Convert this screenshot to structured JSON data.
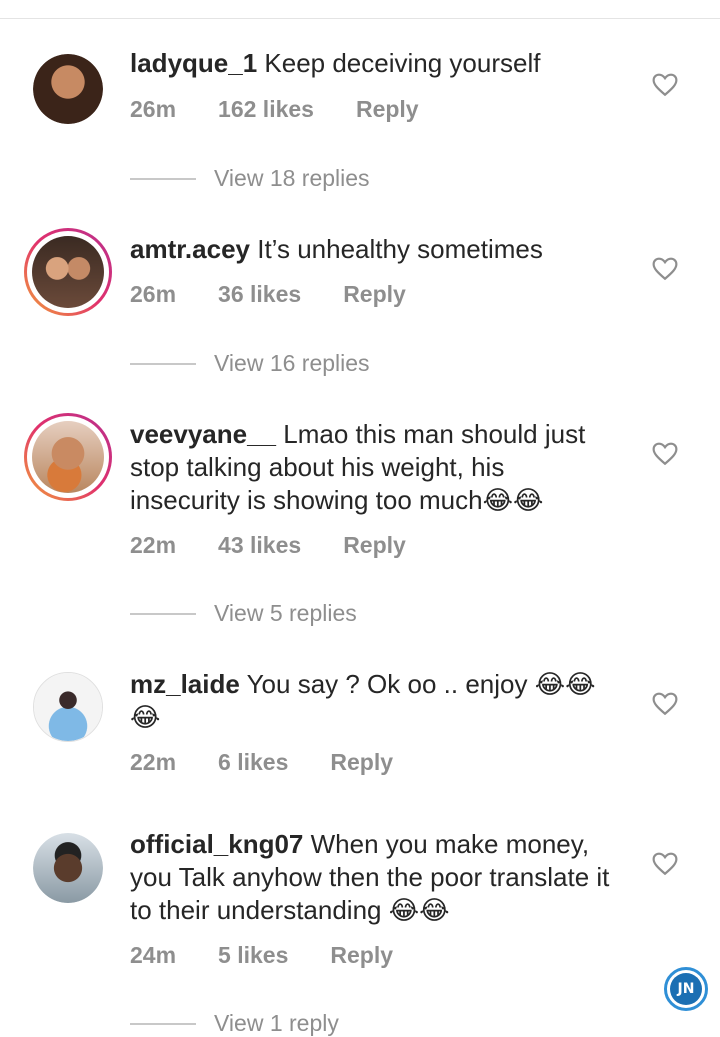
{
  "comments": [
    {
      "username": "ladyque_1",
      "text": "Keep deceiving yourself",
      "time": "26m",
      "likes": "162 likes",
      "reply": "Reply",
      "view_replies": "View 18 replies",
      "avatar_story_ring": false
    },
    {
      "username": "amtr.acey",
      "text": "It’s unhealthy sometimes",
      "time": "26m",
      "likes": "36 likes",
      "reply": "Reply",
      "view_replies": "View 16 replies",
      "avatar_story_ring": true
    },
    {
      "username": "veevyane__",
      "text": "Lmao this man should just stop talking about his weight, his insecurity is showing too much",
      "emojis": "😂😂",
      "time": "22m",
      "likes": "43 likes",
      "reply": "Reply",
      "view_replies": "View 5 replies",
      "avatar_story_ring": true
    },
    {
      "username": "mz_laide",
      "text": "You say ? Ok oo .. enjoy",
      "emojis": "😂😂😂",
      "time": "22m",
      "likes": "6 likes",
      "reply": "Reply",
      "avatar_story_ring": false
    },
    {
      "username": "official_kng07",
      "text": "When you make money, you Talk anyhow then the poor translate it to their understanding",
      "emojis": "😂😂",
      "time": "24m",
      "likes": "5 likes",
      "reply": "Reply",
      "view_replies": "View 1 reply",
      "avatar_story_ring": false
    }
  ],
  "watermark": {
    "text": "JN"
  },
  "colors": {
    "text": "#262626",
    "meta": "#8e8e8e",
    "ring_start": "#f2a23a",
    "ring_end": "#b7308f",
    "watermark": "#1b6fb3"
  },
  "icons": {
    "like": "heart-outline-icon",
    "emoji": "face-with-tears-of-joy"
  }
}
